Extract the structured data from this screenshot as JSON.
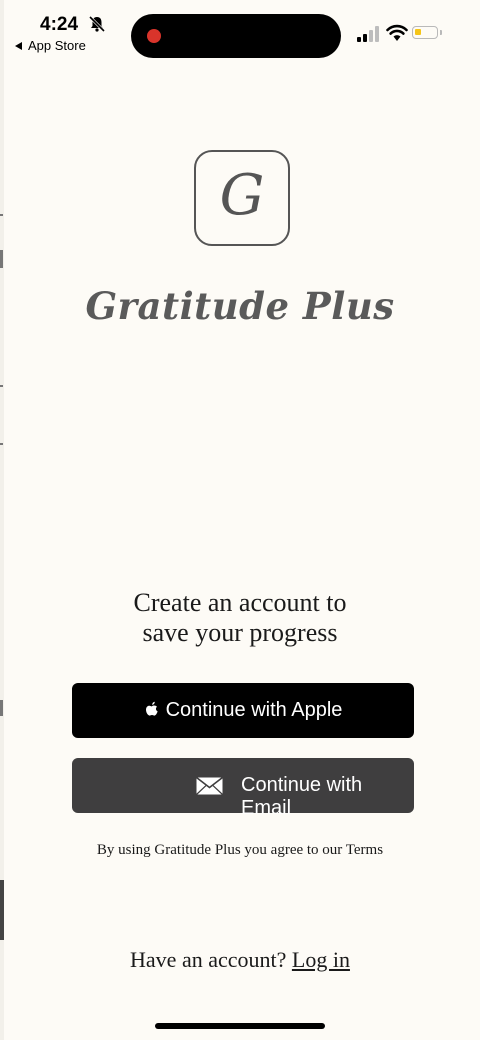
{
  "status_bar": {
    "time": "4:24",
    "back_app": "App Store",
    "battery_color": "#f5c518",
    "recording_color": "#d9342b"
  },
  "logo": {
    "letter": "G",
    "app_name": "Gratitude Plus"
  },
  "headline": {
    "line1": "Create an account to",
    "line2": "save your progress"
  },
  "buttons": {
    "apple_label": "Continue with Apple",
    "email_label": "Continue with Email"
  },
  "terms_text": "By using Gratitude Plus you agree to our Terms",
  "login": {
    "prompt": "Have an account?",
    "link": "Log in"
  },
  "icons": [
    "bell-slash-icon",
    "signal-icon",
    "wifi-icon",
    "battery-icon",
    "apple-icon",
    "mail-icon"
  ]
}
